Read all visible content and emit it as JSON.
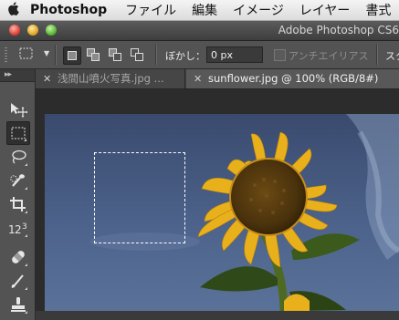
{
  "menubar": {
    "apple_icon": "apple-icon",
    "app_name": "Photoshop",
    "items": [
      "ファイル",
      "編集",
      "イメージ",
      "レイヤー",
      "書式"
    ]
  },
  "window": {
    "title": "Adobe Photoshop CS6"
  },
  "options_bar": {
    "feather_label": "ぼかし：",
    "feather_value": "0 px",
    "antialias_label": "アンチエイリアス",
    "style_label": "スタイル"
  },
  "tabs": [
    {
      "label": "浅間山噴火写真.jpg ...",
      "active": false
    },
    {
      "label": "sunflower.jpg @ 100% (RGB/8#)",
      "active": true
    }
  ],
  "tools": [
    "move-tool",
    "rectangular-marquee-tool",
    "lasso-tool",
    "quick-selection-tool",
    "crop-tool",
    "eyedropper-tool",
    "healing-brush-tool",
    "brush-tool",
    "clone-stamp-tool"
  ],
  "colors": {
    "ui_dark": "#535353",
    "sky": "#4a5f86",
    "petal": "#e8b11c"
  }
}
